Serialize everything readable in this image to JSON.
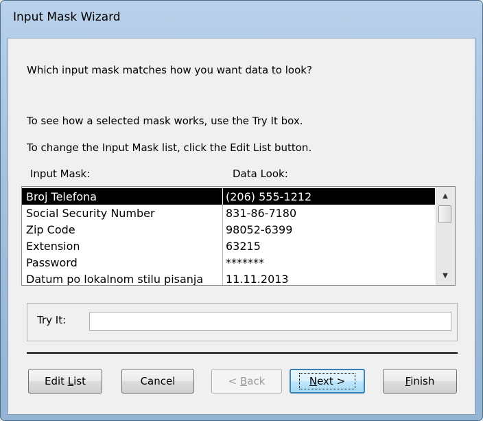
{
  "window": {
    "title": "Input Mask Wizard"
  },
  "instructions": {
    "question": "Which input mask matches how you want data to look?",
    "try_hint": "To see how a selected mask works, use the Try It box.",
    "edit_hint": "To change the Input Mask list, click the Edit List button."
  },
  "list": {
    "headers": {
      "input_mask": "Input Mask:",
      "data_look": "Data Look:"
    },
    "rows": [
      {
        "mask": "Broj Telefona",
        "look": "(206) 555-1212",
        "selected": true
      },
      {
        "mask": "Social Security Number",
        "look": "831-86-7180",
        "selected": false
      },
      {
        "mask": "Zip Code",
        "look": "98052-6399",
        "selected": false
      },
      {
        "mask": "Extension",
        "look": "63215",
        "selected": false
      },
      {
        "mask": "Password",
        "look": "*******",
        "selected": false
      },
      {
        "mask": "Datum po lokalnom stilu pisanja",
        "look": "11.11.2013",
        "selected": false
      }
    ]
  },
  "tryit": {
    "label": "Try It:",
    "value": ""
  },
  "buttons": {
    "edit_list": {
      "pre": "Edit ",
      "accel": "L",
      "post": "ist"
    },
    "cancel": {
      "label": "Cancel"
    },
    "back": {
      "pre": "< ",
      "accel": "B",
      "post": "ack"
    },
    "next": {
      "pre": "",
      "accel": "N",
      "post": "ext >"
    },
    "finish": {
      "pre": "",
      "accel": "F",
      "post": "inish"
    }
  },
  "colors": {
    "selection_bg": "#000000",
    "selection_fg": "#ffffff",
    "default_button_border": "#3c7fb1"
  }
}
